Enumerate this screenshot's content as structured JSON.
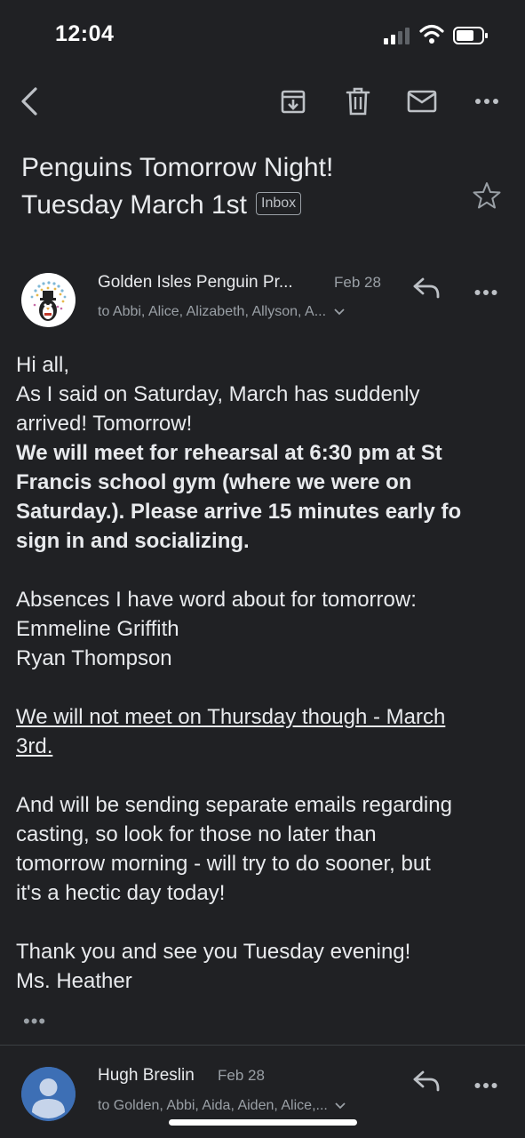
{
  "status_bar": {
    "time": "12:04"
  },
  "toolbar": {
    "back_icon": "back-arrow-icon",
    "archive_icon": "archive-icon",
    "delete_icon": "trash-icon",
    "mark_unread_icon": "mail-icon",
    "more_icon": "more-horizontal-icon"
  },
  "email": {
    "subject_line1": "Penguins Tomorrow Night!",
    "subject_line2": "Tuesday March 1st",
    "label": "Inbox",
    "message": {
      "sender": "Golden Isles Penguin Pr...",
      "date": "Feb 28",
      "recipients": "to Abbi, Alice, Alizabeth, Allyson, A...",
      "body": {
        "l1": "Hi all,",
        "l2": "As I said on Saturday, March has suddenly",
        "l3": "arrived! Tomorrow!",
        "b1": "We will meet for rehearsal at 6:30 pm at St",
        "b2": "Francis school gym (where we were on",
        "b3": "Saturday.). Please arrive 15 minutes early fo",
        "b4": "sign in and socializing.",
        "a1": "Absences I have word about for tomorrow:",
        "a2": "Emmeline Griffith",
        "a3": "Ryan Thompson",
        "u1": "We will not meet on Thursday though - March",
        "u2": "3rd.",
        "c1": "And will be sending separate emails regarding",
        "c2": "casting, so look for those no later than",
        "c3": "tomorrow morning - will try to do sooner, but",
        "c4": "it's a hectic day today!",
        "t1": "Thank you and see you Tuesday evening!",
        "t2": "Ms. Heather"
      },
      "trimmed_content": "•••"
    },
    "reply": {
      "sender": "Hugh Breslin",
      "date": "Feb 28",
      "recipients": "to Golden, Abbi, Aida, Aiden, Alice,..."
    }
  },
  "colors": {
    "background": "#202124",
    "text": "#e8eaed",
    "secondary_text": "#9aa0a6",
    "avatar_blue": "#3d6fb5"
  }
}
